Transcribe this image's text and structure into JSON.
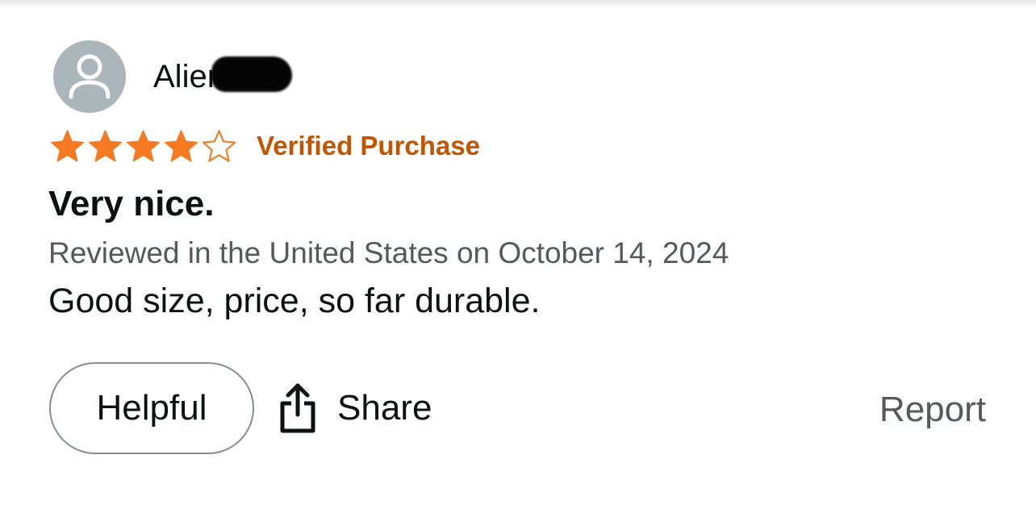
{
  "review": {
    "reviewer": {
      "name": "Alien",
      "name_redacted": true,
      "avatar_icon": "default-user-avatar-icon"
    },
    "rating": {
      "value": 4,
      "max": 5,
      "filled_color": "#f47921",
      "empty_color": "#f47921"
    },
    "verified_label": "Verified Purchase",
    "verified_color": "#c45500",
    "title": "Very nice.",
    "meta": "Reviewed in the United States on October 14, 2024",
    "body": "Good size, price, so far durable."
  },
  "actions": {
    "helpful_label": "Helpful",
    "share_label": "Share",
    "share_icon": "share-icon",
    "report_label": "Report"
  }
}
